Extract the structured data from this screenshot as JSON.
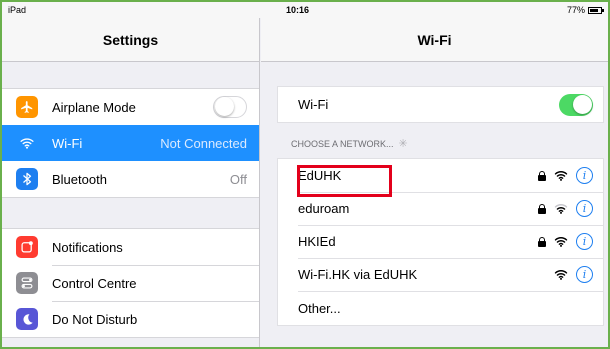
{
  "status": {
    "carrier": "iPad",
    "time": "10:16",
    "battery": "77%"
  },
  "left": {
    "title": "Settings",
    "group1": [
      {
        "label": "Airplane Mode",
        "icon": "airplane-icon",
        "color": "#ff9500",
        "toggle": "off"
      },
      {
        "label": "Wi-Fi",
        "icon": "wifi-icon",
        "color": "#1e90ff",
        "value": "Not Connected",
        "selected": true
      },
      {
        "label": "Bluetooth",
        "icon": "bluetooth-icon",
        "color": "#1e7ff0",
        "value": "Off"
      }
    ],
    "group2": [
      {
        "label": "Notifications",
        "icon": "notifications-icon",
        "color": "#ff3b30"
      },
      {
        "label": "Control Centre",
        "icon": "control-centre-icon",
        "color": "#8e8e93"
      },
      {
        "label": "Do Not Disturb",
        "icon": "moon-icon",
        "color": "#5856d6"
      }
    ]
  },
  "right": {
    "title": "Wi-Fi",
    "wifi_label": "Wi-Fi",
    "wifi_toggle": "on",
    "section_label": "CHOOSE A NETWORK...",
    "networks": [
      {
        "name": "EdUHK",
        "locked": true,
        "signal": "strong"
      },
      {
        "name": "eduroam",
        "locked": true,
        "signal": "weak"
      },
      {
        "name": "HKIEd",
        "locked": true,
        "signal": "strong"
      },
      {
        "name": "Wi-Fi.HK via EdUHK",
        "locked": false,
        "signal": "strong"
      }
    ],
    "other_label": "Other..."
  },
  "colors": {
    "accent": "#1e90ff",
    "toggle_on": "#4cd964",
    "highlight": "#e3001b",
    "frame": "#6ab04c"
  }
}
